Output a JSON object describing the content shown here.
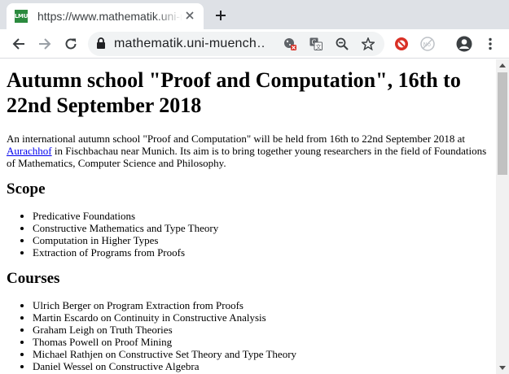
{
  "browser": {
    "tab": {
      "favicon_text": "LMU",
      "title": "https://www.mathematik.uni-muenchen.de"
    },
    "omnibox": {
      "url": "mathematik.uni-muench…"
    },
    "icons": {
      "back": "arrow-left-icon",
      "forward": "arrow-right-icon",
      "reload": "reload-icon",
      "lock": "lock-icon",
      "cookie": "cookie-blocked-icon",
      "translate": "translate-icon",
      "zoom": "zoom-out-icon",
      "bookmark": "star-icon",
      "ext1": "red-circle-extension-icon",
      "ext2": "grey-extension-icon",
      "profile": "profile-icon",
      "menu": "kebab-menu-icon"
    },
    "colors": {
      "tabstrip": "#dee1e6",
      "omnibox": "#f1f3f4",
      "link": "#0000ee"
    }
  },
  "page": {
    "title": "Autumn school \"Proof and Computation\", 16th to 22nd September 2018",
    "intro": {
      "before_link": "An international autumn school \"Proof and Computation\" will be held from 16th to 22nd September 2018 at ",
      "link": "Aurachhof",
      "after_link": " in Fischbachau near Munich. Its aim is to bring together young researchers in the field of Foundations of Mathematics, Computer Science and Philosophy."
    },
    "scope": {
      "heading": "Scope",
      "items": [
        "Predicative Foundations",
        "Constructive Mathematics and Type Theory",
        "Computation in Higher Types",
        "Extraction of Programs from Proofs"
      ]
    },
    "courses": {
      "heading": "Courses",
      "items": [
        "Ulrich Berger on Program Extraction from Proofs",
        "Martin Escardo on Continuity in Constructive Analysis",
        "Graham Leigh on Truth Theories",
        "Thomas Powell on Proof Mining",
        "Michael Rathjen on Constructive Set Theory and Type Theory",
        "Daniel Wessel on Constructive Algebra"
      ]
    }
  }
}
